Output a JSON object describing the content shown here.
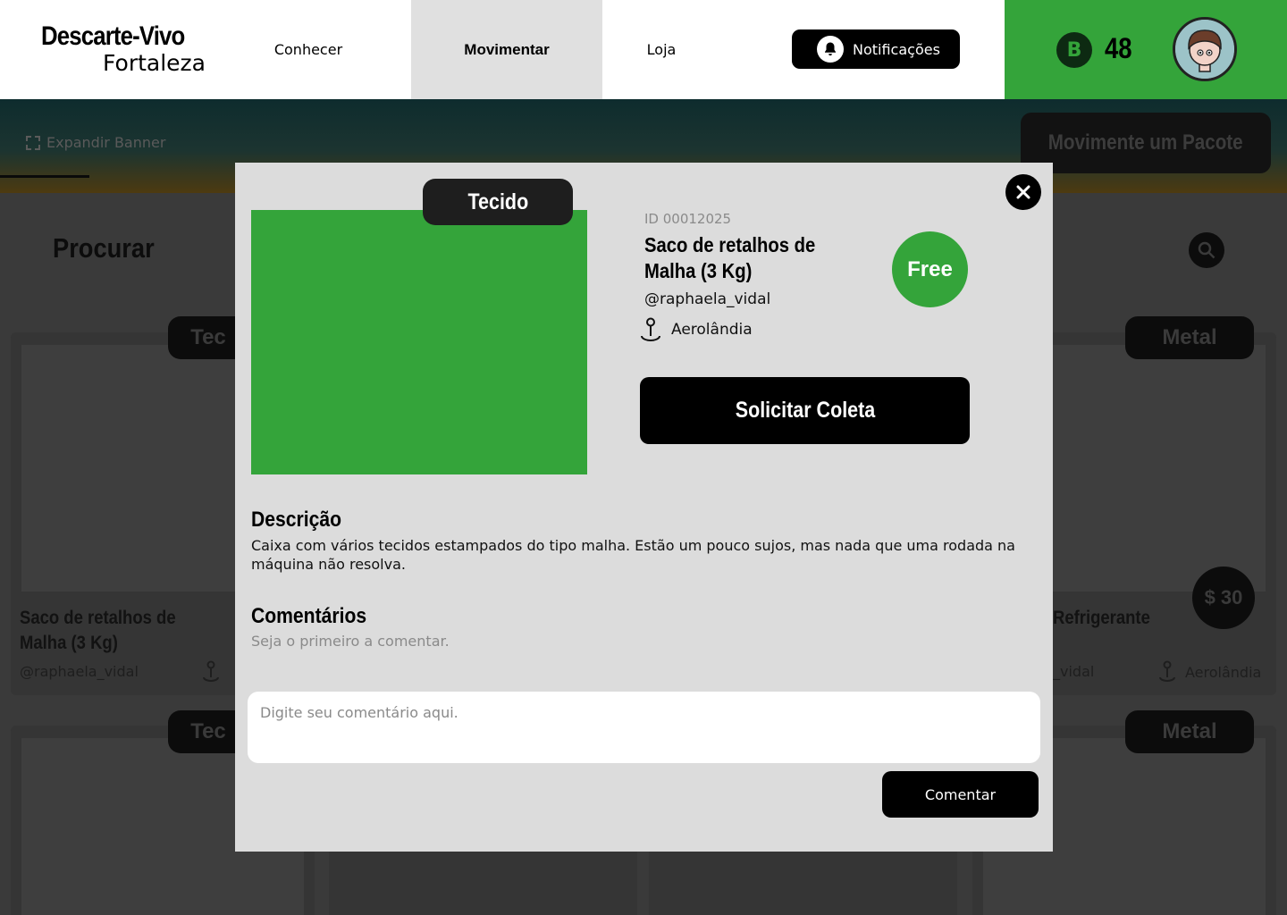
{
  "colors": {
    "brand_green": "#34a43a",
    "black": "#000000",
    "modal_bg": "#dcdcdc",
    "overlay": "#3a3a3a"
  },
  "header": {
    "logo_line1": "Descarte-Vivo",
    "logo_line2": "Fortaleza",
    "nav": {
      "conhecer": "Conhecer",
      "movimentar": "Movimentar",
      "loja": "Loja"
    },
    "active_nav": "movimentar",
    "notifications_label": "Notificações",
    "notifications_icon": "bell-icon",
    "coin_symbol": "B",
    "coin_icon": "coin-icon",
    "coin_count": "48",
    "avatar_icon": "avatar-icon"
  },
  "background": {
    "expand_banner_label": "Expandir Banner",
    "move_package_label": "Movimente um Pacote",
    "search_heading": "Procurar",
    "search_icon": "search-icon",
    "cards": [
      {
        "tag": "Tec",
        "title": "Saco de retalhos de Malha (3 Kg)",
        "user": "@raphaela_vidal"
      },
      {
        "tag": "Metal",
        "title": "Refrigerante",
        "user": "_vidal",
        "price": "$ 30",
        "location": "Aerolândia"
      },
      {
        "tag": "Tec"
      },
      {
        "tag": "Metal"
      }
    ]
  },
  "modal": {
    "category_tag": "Tecido",
    "close_icon": "close-icon",
    "item_id": "ID 00012025",
    "title": "Saco de retalhos de Malha (3 Kg)",
    "price_badge": "Free",
    "user": "@raphaela_vidal",
    "location_icon": "location-pin-icon",
    "location": "Aerolândia",
    "request_button": "Solicitar Coleta",
    "description_heading": "Descrição",
    "description": "Caixa com vários tecidos estampados do tipo malha. Estão um pouco sujos, mas nada que uma rodada na máquina não resolva.",
    "comments_heading": "Comentários",
    "no_comments": "Seja o primeiro a comentar.",
    "comment_placeholder": "Digite seu comentário aqui.",
    "comment_value": "",
    "comment_button": "Comentar"
  }
}
